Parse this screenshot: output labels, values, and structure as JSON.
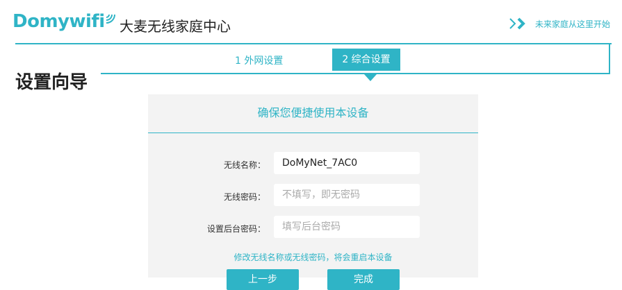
{
  "header": {
    "logo_text": "Domywifi",
    "app_title": "大麦无线家庭中心",
    "start_link": "未来家庭从这里开始"
  },
  "steps": [
    {
      "label": "1 外网设置",
      "active": false
    },
    {
      "label": "2 综合设置",
      "active": true
    }
  ],
  "page_title": "设置向导",
  "card": {
    "title": "确保您便捷使用本设备",
    "fields": [
      {
        "label": "无线名称：",
        "value": "DoMyNet_7AC0",
        "placeholder": ""
      },
      {
        "label": "无线密码：",
        "value": "",
        "placeholder": "不填写，即无密码"
      },
      {
        "label": "设置后台密码：",
        "value": "",
        "placeholder": "填写后台密码"
      }
    ],
    "hint": "修改无线名称或无线密码，将会重启本设备",
    "prev_button": "上一步",
    "done_button": "完成"
  },
  "colors": {
    "accent": "#2fb4c6",
    "card_bg": "#f3f3f3"
  }
}
